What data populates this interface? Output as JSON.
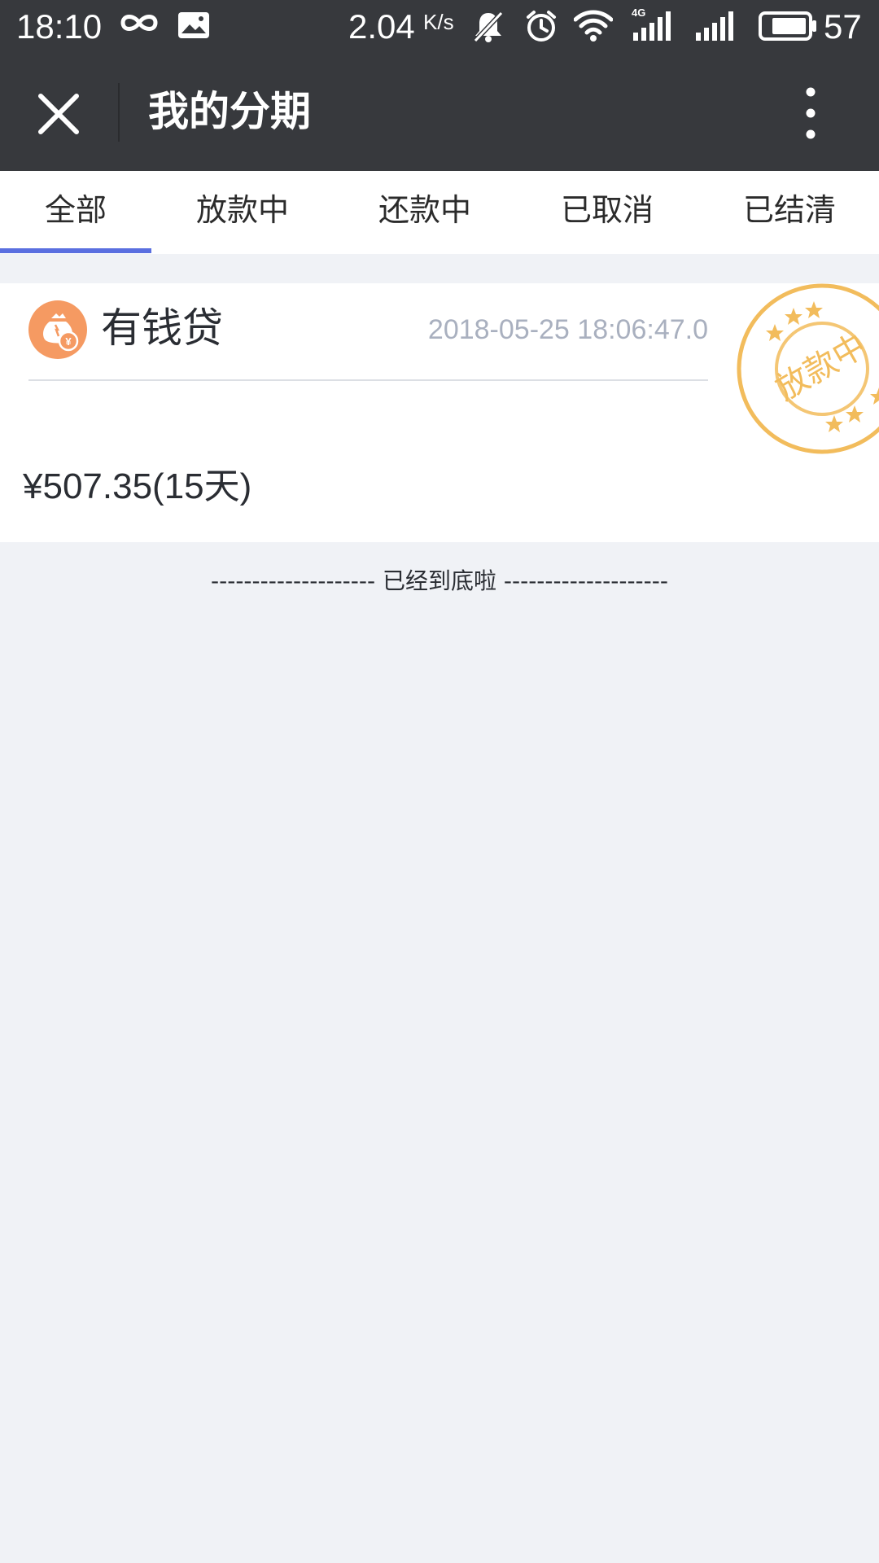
{
  "status_bar": {
    "time": "18:10",
    "network_speed": "2.04",
    "network_speed_unit": "K/s",
    "network_type": "4G",
    "battery_level": "57",
    "icons": [
      "infinity-icon",
      "gallery-icon",
      "mute-icon",
      "alarm-icon",
      "wifi-icon",
      "signal-4g-icon",
      "signal-icon",
      "battery-icon"
    ]
  },
  "title_bar": {
    "title": "我的分期",
    "close_icon": "close-icon",
    "more_icon": "more-vertical-icon"
  },
  "tabs": [
    {
      "label": "全部",
      "active": true
    },
    {
      "label": "放款中",
      "active": false
    },
    {
      "label": "还款中",
      "active": false
    },
    {
      "label": "已取消",
      "active": false
    },
    {
      "label": "已结清",
      "active": false
    }
  ],
  "loan": {
    "name": "有钱贷",
    "datetime": "2018-05-25 18:06:47.0",
    "amount": "¥507.35(15天)",
    "status_stamp": "放款中",
    "logo_icon": "money-bag-icon"
  },
  "footer": {
    "text": "-------------------- 已经到底啦 --------------------"
  },
  "colors": {
    "header_bg": "#37393d",
    "tab_active_underline": "#5a6fe0",
    "page_bg": "#f0f2f6",
    "logo_orange": "#f59a62",
    "stamp_color": "#f2bc5c",
    "datetime_gray": "#a9b0bf"
  }
}
